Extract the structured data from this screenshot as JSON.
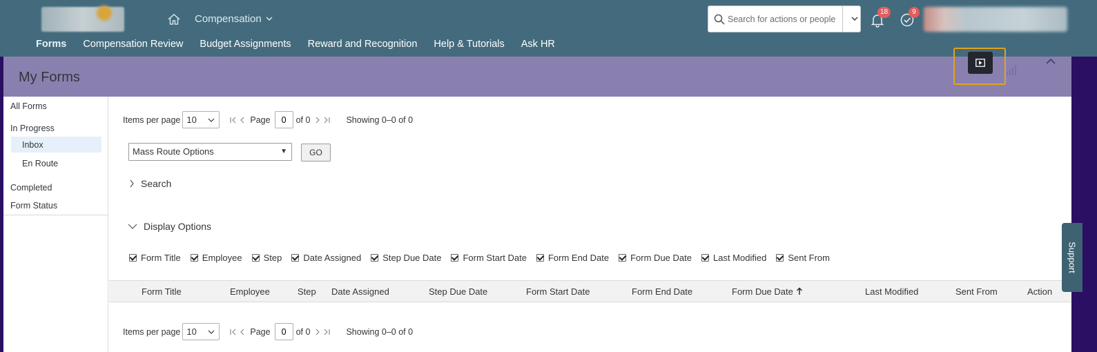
{
  "header": {
    "module": "Compensation",
    "search_placeholder": "Search for actions or people",
    "notifications_count": "18",
    "tasks_count": "9"
  },
  "nav": {
    "items": [
      "Forms",
      "Compensation Review",
      "Budget Assignments",
      "Reward and Recognition",
      "Help & Tutorials",
      "Ask HR"
    ]
  },
  "page": {
    "title": "My Forms"
  },
  "sidebar": {
    "all_forms": "All Forms",
    "in_progress": "In Progress",
    "inbox": "Inbox",
    "en_route": "En Route",
    "completed": "Completed",
    "form_status": "Form Status"
  },
  "pager": {
    "items_per_page_label": "Items per page",
    "items_per_page_value": "10",
    "page_label": "Page",
    "page_value": "0",
    "of_label": "of 0",
    "showing": "Showing 0–0 of 0"
  },
  "mass_route": {
    "selected": "Mass Route Options",
    "go_label": "GO"
  },
  "sections": {
    "search": "Search",
    "display_options": "Display Options"
  },
  "display_options": [
    "Form Title",
    "Employee",
    "Step",
    "Date Assigned",
    "Step Due Date",
    "Form Start Date",
    "Form End Date",
    "Form Due Date",
    "Last Modified",
    "Sent From"
  ],
  "table": {
    "columns": [
      "Form Title",
      "Employee",
      "Step",
      "Date Assigned",
      "Step Due Date",
      "Form Start Date",
      "Form End Date",
      "Form Due Date",
      "Last Modified",
      "Sent From",
      "Action"
    ]
  },
  "support_label": "Support",
  "colors": {
    "shell": "#436b7d",
    "page_header": "#8a80b0",
    "highlight_border": "#e3a31b",
    "badge": "#e25d5d",
    "selected_item": "#e5f0fa"
  }
}
